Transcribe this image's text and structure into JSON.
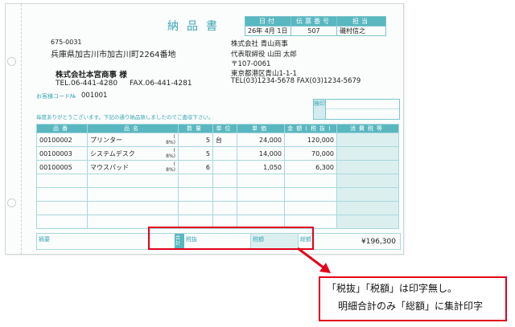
{
  "document": {
    "title": "納品書",
    "meta": {
      "headers": [
        "日付",
        "伝票番号",
        "担当"
      ],
      "values": [
        "26年 4月 1日",
        "507",
        "磯村信之"
      ]
    },
    "recipient": {
      "postal": "675-0031",
      "address": "兵庫県加古川市加古川町2264番地",
      "company": "株式会社本宮商事 様",
      "tel": "TEL.06-441-4280",
      "fax": "FAX.06-441-4281"
    },
    "sender": {
      "company": "株式会社 青山商事",
      "representative": "代表取締役 山田 太郎",
      "postal": "〒107-0061",
      "address": "東京都港区青山1-1-1",
      "tel_fax": "TEL(03)1234-5678 FAX(03)1234-5679"
    },
    "customer_code_label": "お客様コード№",
    "customer_code": "001001",
    "message": "毎度ありがとうございます。下記の通り納品致しましたのでご査収下さい。",
    "inspection_label": "検印",
    "columns": [
      "品番",
      "品名",
      "数量",
      "単位",
      "単価",
      "金額(税抜)",
      "消費税等"
    ],
    "rows": [
      {
        "code": "00100002",
        "name": "プリンター",
        "tax": "( 8%)",
        "qty": "5",
        "unit": "台",
        "price": "24,000",
        "amount": "120,000"
      },
      {
        "code": "00100003",
        "name": "システムデスク",
        "tax": "( 8%)",
        "qty": "5",
        "unit": "",
        "price": "14,000",
        "amount": "70,000"
      },
      {
        "code": "00100005",
        "name": "マウスパッド",
        "tax": "( 8%)",
        "qty": "6",
        "unit": "",
        "price": "1,050",
        "amount": "6,300"
      }
    ],
    "footer": {
      "remarks_label": "摘要",
      "total_label": "合計",
      "subtotal_label": "税抜",
      "tax_label": "税額",
      "grand_label": "総額",
      "grand_total": "¥196,300"
    }
  },
  "callout": {
    "line1": "「税抜」「税額」は印字無し。",
    "line2": "明細合計のみ「総額」に集計印字"
  },
  "colors": {
    "accent": "#59b7c0",
    "highlight": "#e3001b"
  }
}
